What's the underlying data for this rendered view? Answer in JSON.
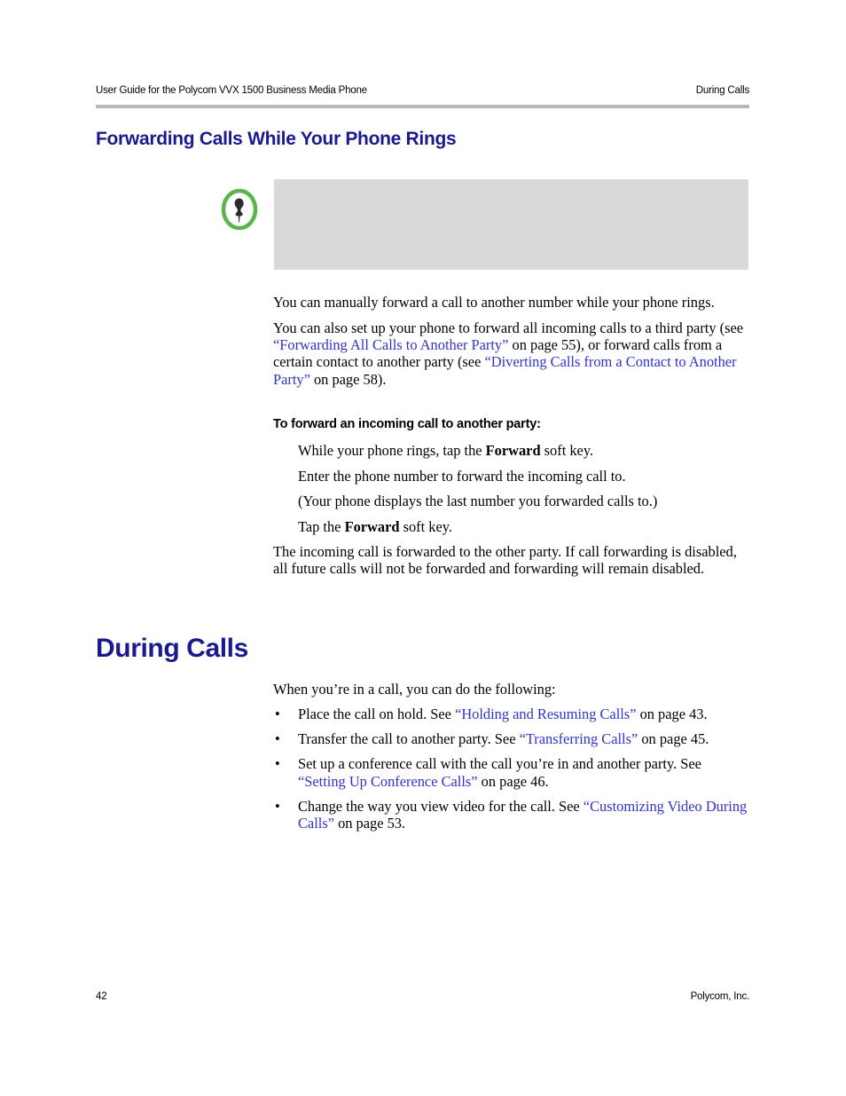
{
  "header": {
    "left_text": "User Guide for the Polycom VVX 1500 Business Media Phone",
    "right_text": "During Calls"
  },
  "section_heading": "Forwarding Calls While Your Phone Rings",
  "note": {
    "icon_name": "note-pushpin-icon",
    "icon_ring_color": "#5cb548",
    "icon_pin_color": "#2b2b2b",
    "background_color": "#d9d9d9",
    "text": ""
  },
  "intro": {
    "paragraph_1": "You can manually forward a call to another number while your phone rings.",
    "paragraph_2": {
      "part_1": "You can also set up your phone to forward all incoming calls to a third party (see ",
      "link_1": "“Forwarding All Calls to Another Party”",
      "part_2": " on page 55), or forward calls from a certain contact to another party (see ",
      "link_2": "“Diverting Calls from a Contact to Another Party”",
      "part_3": " on page 58)."
    }
  },
  "procedure": {
    "heading": "To forward an incoming call to another party:",
    "steps": [
      {
        "part_1": "While your phone rings, tap the ",
        "emphasis": "Forward",
        "part_2": " soft key."
      },
      {
        "part_1": "Enter the phone number to forward the incoming call to.",
        "emphasis": "",
        "part_2": ""
      },
      {
        "part_1": "(Your phone displays the last number you forwarded calls to.)",
        "emphasis": "",
        "part_2": ""
      },
      {
        "part_1": "Tap the ",
        "emphasis": "Forward",
        "part_2": " soft key."
      }
    ],
    "result": "The incoming call is forwarded to the other party. If call forwarding is disabled, all future calls will not be forwarded and forwarding will remain disabled."
  },
  "during_calls": {
    "heading": "During Calls",
    "intro": "When you’re in a call, you can do the following:",
    "bullet_marker": "•",
    "items": [
      {
        "part_1": "Place the call on hold. See ",
        "link": "“Holding and Resuming Calls”",
        "part_2": " on page 43."
      },
      {
        "part_1": "Transfer the call to another party. See ",
        "link": "“Transferring Calls”",
        "part_2": " on page 45."
      },
      {
        "part_1": "Set up a conference call with the call you’re in and another party. See ",
        "link": "“Setting Up Conference Calls”",
        "part_2": " on page 46."
      },
      {
        "part_1": "Change the way you view video for the call. See ",
        "link": "“Customizing Video During Calls”",
        "part_2": " on page 53."
      }
    ]
  },
  "footer": {
    "page_number": "42",
    "company": "Polycom, Inc."
  },
  "colors": {
    "heading_navy": "#1a1a8e",
    "link_blue": "#3232cd",
    "rule_gray": "#b8b8b8",
    "note_gray": "#d9d9d9",
    "icon_green": "#5cb548"
  }
}
